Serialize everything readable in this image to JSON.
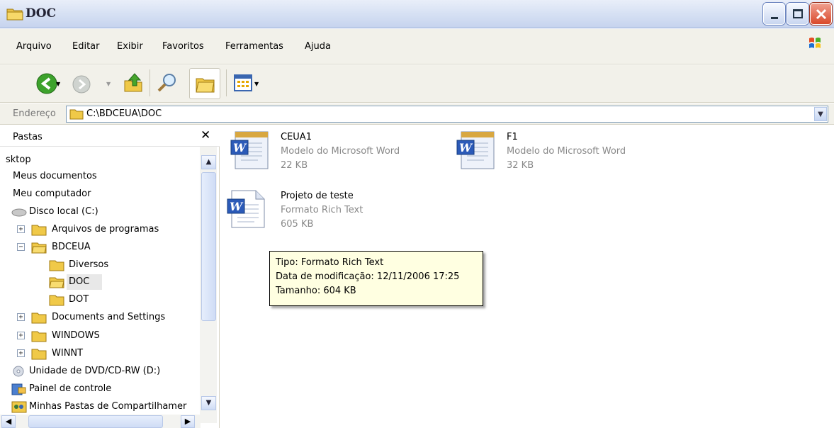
{
  "window": {
    "title": "DOC"
  },
  "menu": [
    "Arquivo",
    "Editar",
    "Exibir",
    "Favoritos",
    "Ferramentas",
    "Ajuda"
  ],
  "toolbar": {
    "icons": [
      "back-icon",
      "forward-icon",
      "up-folder-icon",
      "search-icon",
      "folders-icon",
      "views-icon"
    ]
  },
  "address": {
    "label": "Endereço",
    "value": "C:\\BDCEUA\\DOC"
  },
  "folders_pane": {
    "title": "Pastas",
    "items": [
      {
        "label": "sktop"
      },
      {
        "label": "Meus documentos"
      },
      {
        "label": "Meu computador"
      },
      {
        "label": "Disco local (C:)"
      },
      {
        "label": "Arquivos de programas"
      },
      {
        "label": "BDCEUA"
      },
      {
        "label": "Diversos"
      },
      {
        "label": "DOC"
      },
      {
        "label": "DOT"
      },
      {
        "label": "Documents and Settings"
      },
      {
        "label": "WINDOWS"
      },
      {
        "label": "WINNT"
      },
      {
        "label": "Unidade de DVD/CD-RW (D:)"
      },
      {
        "label": "Painel de controle"
      },
      {
        "label": "Minhas Pastas de Compartilhamer"
      }
    ]
  },
  "files": [
    {
      "name": "CEUA1",
      "type": "Modelo do Microsoft Word",
      "size": "22 KB"
    },
    {
      "name": "F1",
      "type": "Modelo do Microsoft Word",
      "size": "32 KB"
    },
    {
      "name": "Projeto de teste",
      "type": "Formato Rich Text",
      "size": "605 KB"
    }
  ],
  "tooltip": {
    "type": "Tipo: Formato Rich Text",
    "modified": "Data de modificação: 12/11/2006 17:25",
    "size": "Tamanho: 604 KB"
  },
  "colors": {
    "titlebar": "#d8e2f4",
    "menubar": "#f2f1ea",
    "tooltip": "#ffffe1",
    "close": "#d9482a"
  }
}
